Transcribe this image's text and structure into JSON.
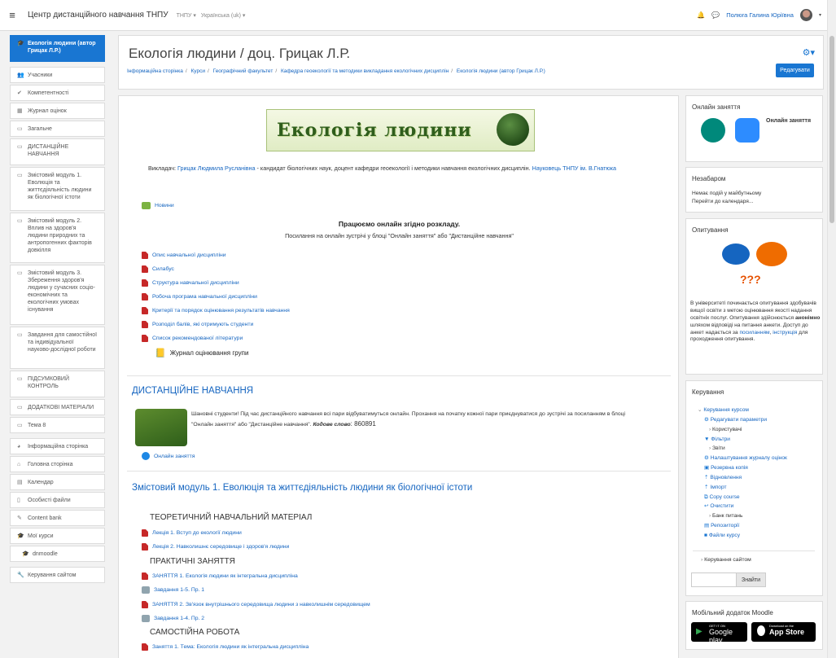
{
  "navbar": {
    "site_name": "Центр дистанційного навчання ТНПУ",
    "menu_tnpu": "ТНПУ ▾",
    "menu_lang": "Українська (uk) ▾",
    "user_name": "Полюга Галина Юріївна"
  },
  "sidebar": {
    "items": [
      {
        "label": "Екологія людини (автор Грицак Л.Р.)",
        "icon": "graduation-cap-icon"
      },
      {
        "label": "Учасники",
        "icon": "users-icon"
      },
      {
        "label": "Компетентності",
        "icon": "check-icon"
      },
      {
        "label": "Журнал оцінок",
        "icon": "table-icon"
      },
      {
        "label": "Загальне",
        "icon": "folder-icon"
      },
      {
        "label": "ДИСТАНЦІЙНЕ НАВЧАННЯ",
        "icon": "folder-icon"
      },
      {
        "label": "Змістовий модуль 1. Еволюція та життєдіяльність людини як біологічної істоти",
        "icon": "folder-icon"
      },
      {
        "label": "Змістовий модуль 2. Вплив на здоров'я людини природних та антропогенних факторів довкілля",
        "icon": "folder-icon"
      },
      {
        "label": "Змістовий модуль 3. Збереження здоров'я людини у сучасних соціо-економічних та екологічних умовах існування",
        "icon": "folder-icon"
      },
      {
        "label": "Завдання для самостійної та індивідуальної науково-дослідної роботи",
        "icon": "folder-icon"
      },
      {
        "label": "ПІДСУМКОВИЙ КОНТРОЛЬ",
        "icon": "folder-icon"
      },
      {
        "label": "ДОДАТКОВІ МАТЕРІАЛИ",
        "icon": "folder-icon"
      },
      {
        "label": "Тема 8",
        "icon": "folder-icon"
      },
      {
        "label": "Інформаційна сторінка",
        "icon": "dashboard-icon"
      },
      {
        "label": "Головна сторінка",
        "icon": "home-icon"
      },
      {
        "label": "Календар",
        "icon": "calendar-icon"
      },
      {
        "label": "Особисті файли",
        "icon": "file-icon"
      },
      {
        "label": "Content bank",
        "icon": "brush-icon"
      },
      {
        "label": "Мої курси",
        "icon": "graduation-cap-icon"
      },
      {
        "label": "dnmoodle",
        "icon": "graduation-cap-icon"
      },
      {
        "label": "Керування сайтом",
        "icon": "wrench-icon"
      }
    ]
  },
  "header": {
    "title": "Екологія людини / доц. Грицак Л.Р.",
    "breadcrumbs": [
      "Інформаційна сторінка",
      "Курси",
      "Географічний факультет",
      "Кафедра геоекології та методики викладання екологічних дисциплін",
      "Екологія людини (автор Грицак Л.Р.)"
    ],
    "edit_button": "Редагувати"
  },
  "main": {
    "banner_text": "Екологія людини",
    "teacher_prefix": "Викладач:",
    "teacher_name": "Грицак Людмила Русланівна",
    "teacher_desc": "- кандидат біологічних наук, доцент кафедри геоекології і методики навчання екологічних дисциплін.",
    "teacher_link2": "Науковець ТНПУ ім. В.Гнатюка",
    "news_link": "Новини",
    "online_heading": "Працюємо онлайн згідно розкладу.",
    "online_sub": "Посилання на онлайн зустрічі у блоці \"Онлайн заняття\" або \"Дистанційне навчання\"",
    "resources": [
      "Опис навчальної дисципліни",
      "Силабус",
      "Структура навчальної дисципліни",
      "Робоча програма навчальної дисципліни",
      "Критерії та порядок оцінювання результатів навчання",
      "Розподіл балів, які отримують студенти",
      "Список рекомендованої літератури"
    ],
    "gradebook_label": "Журнал оцінювання групи",
    "distance": {
      "title": "ДИСТАНЦІЙНЕ НАВЧАННЯ",
      "text1": "Шановні студенти! Під час дистанційного навчання всі пари відбуватимуться онлайн. Прохання на початку кожної пари приєднуватися до зустрічі за посиланням в блоці",
      "text2": "\"Онлайн заняття\" або \"Дистанційне навчання\".",
      "code_label": "Кодове слово",
      "code_value": ": 860891",
      "zoom_link": "Онлайн заняття"
    },
    "module1": {
      "title": "Змістовий модуль 1. Еволюція та життєдіяльність людини як біологічної істоти",
      "theory_heading": "ТЕОРЕТИЧНИЙ НАВЧАЛЬНИЙ МАТЕРІАЛ",
      "lectures": [
        "Лекція 1. Вступ до екології людини",
        "Лекція 2. Навколишнє середовище і здоров'я людини"
      ],
      "practical_heading": "ПРАКТИЧНІ ЗАНЯТТЯ",
      "practical": [
        "ЗАНЯТТЯ 1. Екологія людини як інтегральна дисципліна",
        "Завдання 1-5. Пр. 1",
        "ЗАНЯТТЯ 2. Зв'язок внутрішнього середовища людини з навколишнім середовищем",
        "Завдання 1-4. Пр. 2"
      ],
      "independent_heading": "САМОСТІЙНА РОБОТА",
      "independent": [
        "Заняття 1. Тема: Екологія людини як інтегральна дисципліна"
      ]
    }
  },
  "blocks": {
    "online": {
      "title": "Онлайн заняття",
      "label": "Онлайн заняття"
    },
    "upcoming": {
      "title": "Незабаром",
      "text": "Немає подій у майбутньому",
      "link": "Перейти до календаря..."
    },
    "survey": {
      "title": "Опитування",
      "text_a": "В університеті починається опитування здобувачів вищої освіти з метою оцінювання якості надання освітніх послуг. Опитування здійснюється",
      "text_bold": "анонімно",
      "text_b": "шляхом відповіді на питання анкети. Доступ до анкет надається за",
      "link1": "посиланням",
      "link2": "інструкція",
      "text_c": "для проходження опитування."
    },
    "admin": {
      "title": "Керування",
      "course_admin": "Керування курсом",
      "items": [
        "Редагувати параметри",
        "Користувачі",
        "Фільтри",
        "Звіти",
        "Налаштування журналу оцінок",
        "Резервна копія",
        "Відновлення",
        "Імпорт",
        "Copy course",
        "Очистити",
        "Банк питань",
        "Репозиторії",
        "Файли курсу"
      ],
      "site_admin": "Керування сайтом",
      "search_button": "Знайти"
    },
    "mobile": {
      "title": "Мобільний додаток Moodle",
      "google_small": "GET IT ON",
      "google_big": "Google play",
      "apple_small": "Download on the",
      "apple_big": "App Store"
    }
  },
  "colors": {
    "accent": "#1976d2",
    "link": "#1565c0",
    "pdf": "#c62828"
  }
}
